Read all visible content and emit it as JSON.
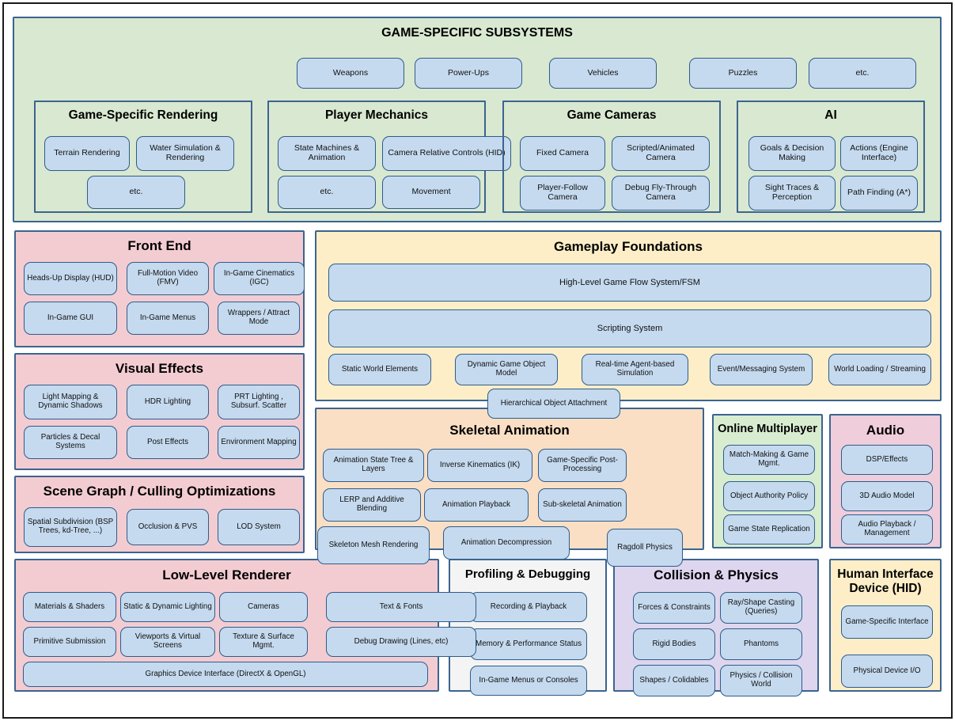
{
  "diagram": {
    "title": "Game Engine Architecture Runtime Layers",
    "accent_border": "#3b6490",
    "leaf_fill": "#c5daef",
    "leaf_border": "#2f5c8a"
  },
  "game_specific": {
    "title": "GAME-SPECIFIC SUBSYSTEMS",
    "fill": "#d9e8d0",
    "top_row": [
      "Weapons",
      "Power-Ups",
      "Vehicles",
      "Puzzles",
      "etc."
    ],
    "groups": [
      {
        "title": "Game-Specific Rendering",
        "items": [
          "Terrain Rendering",
          "Water Simulation & Rendering",
          "etc."
        ]
      },
      {
        "title": "Player Mechanics",
        "items": [
          "State Machines & Animation",
          "Camera Relative Controls (HID)",
          "etc.",
          "Movement"
        ]
      },
      {
        "title": "Game Cameras",
        "items": [
          "Fixed Camera",
          "Scripted/Animated Camera",
          "Player-Follow Camera",
          "Debug Fly-Through Camera"
        ]
      },
      {
        "title": "AI",
        "items": [
          "Goals & Decision Making",
          "Actions (Engine Interface)",
          "Sight Traces & Perception",
          "Path Finding (A*)"
        ]
      }
    ]
  },
  "front_end": {
    "title": "Front End",
    "fill": "#f3ccd2",
    "items": [
      "Heads-Up Display (HUD)",
      "Full-Motion Video (FMV)",
      "In-Game Cinematics (IGC)",
      "In-Game GUI",
      "In-Game Menus",
      "Wrappers / Attract Mode"
    ]
  },
  "visual_effects": {
    "title": "Visual Effects",
    "fill": "#f3ccd2",
    "items": [
      "Light Mapping  & Dynamic Shadows",
      "HDR Lighting",
      "PRT Lighting , Subsurf. Scatter",
      "Particles & Decal Systems",
      "Post Effects",
      "Environment Mapping"
    ]
  },
  "scene_graph": {
    "title": "Scene Graph / Culling Optimizations",
    "fill": "#f3ccd2",
    "items": [
      "Spatial Subdivision (BSP Trees, kd-Tree, ...)",
      "Occlusion & PVS",
      "LOD System"
    ]
  },
  "gameplay_foundations": {
    "title": "Gameplay Foundations",
    "fill": "#fdeec8",
    "wide_items": [
      "High-Level Game Flow System/FSM",
      "Scripting System"
    ],
    "items": [
      "Static World Elements",
      "Dynamic Game Object Model",
      "Real-time Agent-based Simulation",
      "Event/Messaging System",
      "World Loading / Streaming"
    ],
    "floating": "Hierarchical Object Attachment"
  },
  "skeletal_animation": {
    "title": "Skeletal Animation",
    "fill": "#fbdfc4",
    "items": [
      "Animation State Tree & Layers",
      "Inverse Kinematics (IK)",
      "Game-Specific Post-Processing",
      "LERP and Additive Blending",
      "Animation Playback",
      "Sub-skeletal Animation",
      "Animation Decompression"
    ],
    "floating_left": "Skeleton Mesh Rendering",
    "floating_right": "Ragdoll Physics"
  },
  "online_multiplayer": {
    "title": "Online Multiplayer",
    "fill": "#d8ecd0",
    "items": [
      "Match-Making & Game Mgmt.",
      "Object Authority Policy",
      "Game State Replication"
    ]
  },
  "audio": {
    "title": "Audio",
    "fill": "#f0cddb",
    "items": [
      "DSP/Effects",
      "3D Audio Model",
      "Audio Playback / Management"
    ]
  },
  "low_level_renderer": {
    "title": "Low-Level Renderer",
    "fill": "#f3ccd2",
    "items": [
      "Materials & Shaders",
      "Static & Dynamic Lighting",
      "Cameras",
      "Text & Fonts",
      "Primitive Submission",
      "Viewports & Virtual Screens",
      "Texture & Surface Mgmt.",
      "Debug Drawing (Lines, etc)"
    ],
    "wide_item": "Graphics Device Interface (DirectX & OpenGL)"
  },
  "profiling_debugging": {
    "title": "Profiling & Debugging",
    "fill": "#f4f4f4",
    "items": [
      "Recording & Playback",
      "Memory & Performance Status",
      "In-Game Menus or Consoles"
    ]
  },
  "collision_physics": {
    "title": "Collision & Physics",
    "fill": "#ded6ee",
    "items": [
      "Forces & Constraints",
      "Ray/Shape Casting (Queries)",
      "Rigid Bodies",
      "Phantoms",
      "Shapes / Colidables",
      "Physics / Collision World"
    ]
  },
  "hid": {
    "title": "Human Interface Device (HID)",
    "fill": "#fdeec8",
    "items": [
      "Game-Specific Interface",
      "Physical Device I/O"
    ]
  }
}
